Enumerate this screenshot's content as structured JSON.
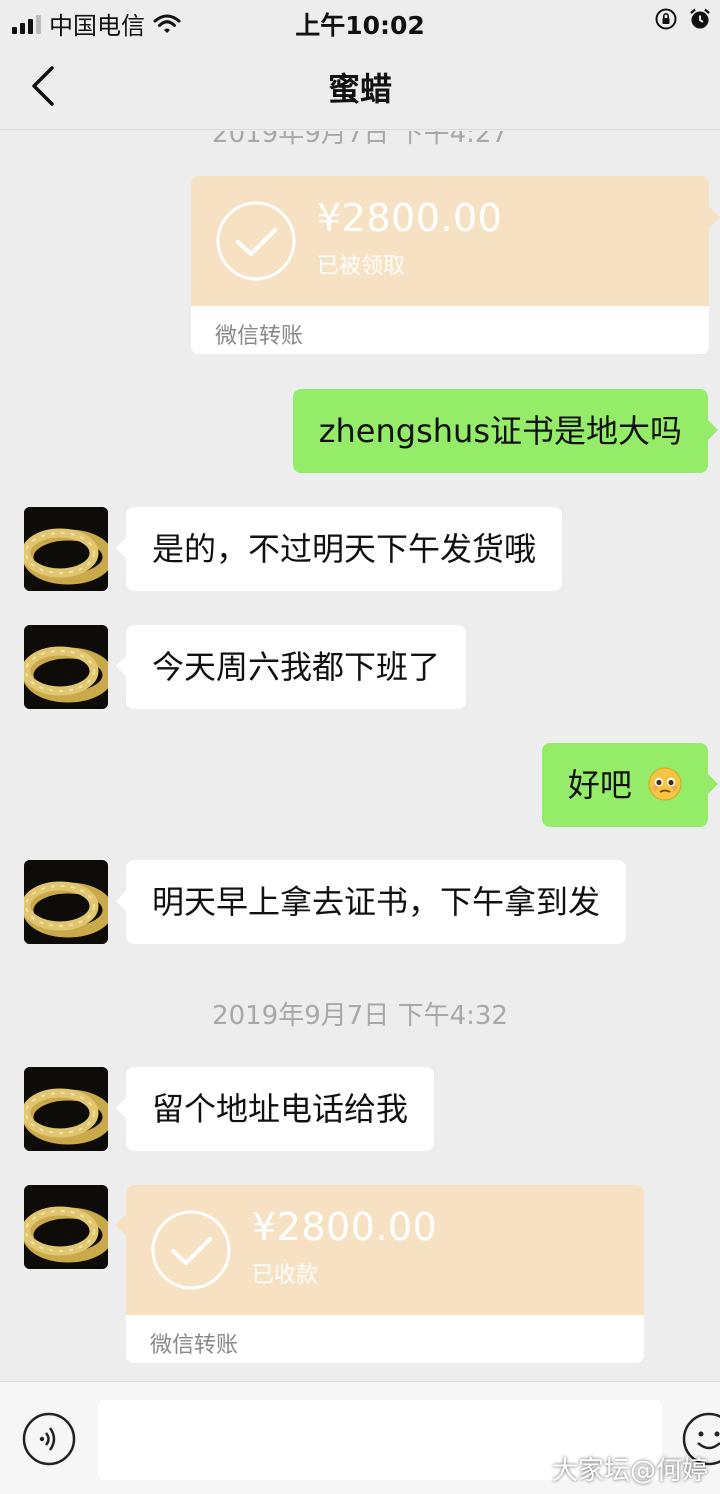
{
  "status_bar": {
    "carrier": "中国电信",
    "time": "上午10:02"
  },
  "nav": {
    "title": "蜜蜡"
  },
  "chat": {
    "clipped_timestamp": "2019年9月7日 下午4:27",
    "messages": [
      {
        "type": "transfer",
        "direction": "out",
        "amount": "¥2800.00",
        "status": "已被领取",
        "footer": "微信转账"
      },
      {
        "type": "text",
        "direction": "out",
        "text": "zhengshus证书是地大吗"
      },
      {
        "type": "text",
        "direction": "in",
        "text": "是的，不过明天下午发货哦"
      },
      {
        "type": "text",
        "direction": "in",
        "text": "今天周六我都下班了"
      },
      {
        "type": "text",
        "direction": "out",
        "text": "好吧",
        "emoji": "pleading-face-icon"
      },
      {
        "type": "text",
        "direction": "in",
        "text": "明天早上拿去证书，下午拿到发"
      },
      {
        "type": "timestamp",
        "text": "2019年9月7日 下午4:32"
      },
      {
        "type": "text",
        "direction": "in",
        "text": "留个地址电话给我"
      },
      {
        "type": "transfer",
        "direction": "in",
        "amount": "¥2800.00",
        "status": "已收款",
        "footer": "微信转账"
      }
    ]
  },
  "input_bar": {
    "value": "",
    "placeholder": ""
  },
  "watermark": "大家坛@何婷",
  "colors": {
    "background": "#ededed",
    "outgoing_bubble": "#95ec69",
    "incoming_bubble": "#ffffff",
    "transfer": "#f7e1c3"
  }
}
